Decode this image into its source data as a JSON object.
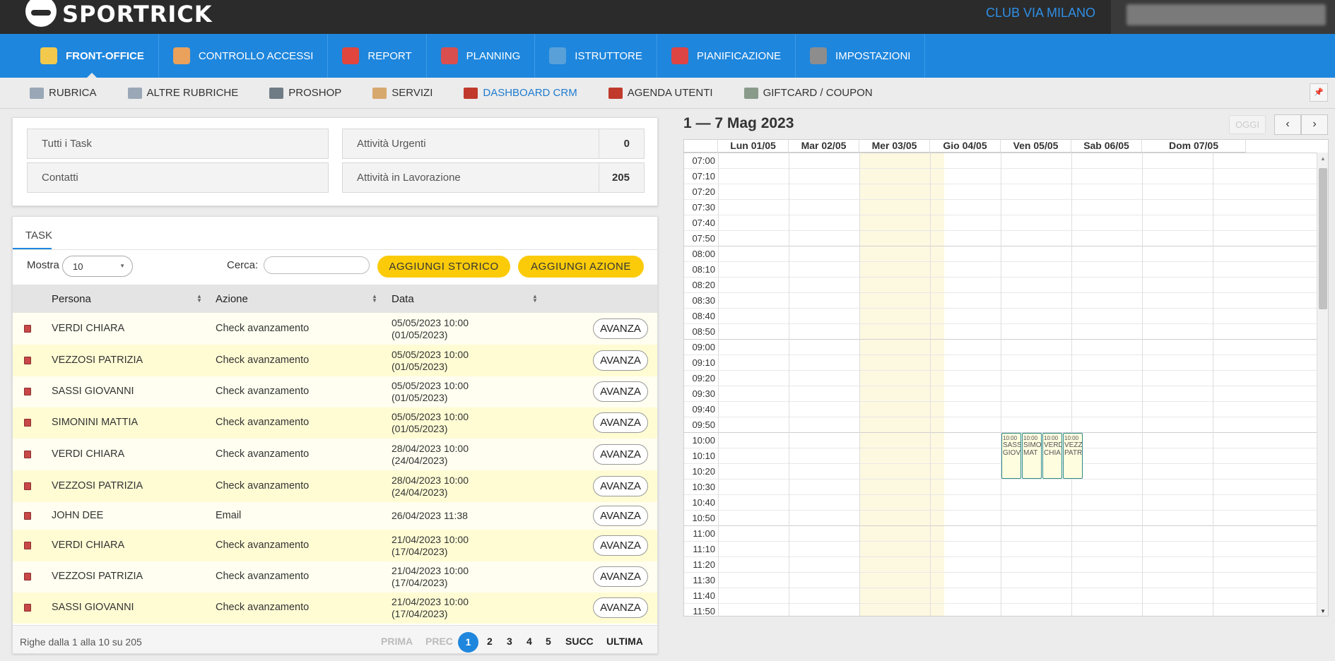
{
  "app": {
    "logo_text": "SPORTRICK",
    "club": "CLUB VIA MILANO"
  },
  "colors": {
    "topbar": "#2b2b2b",
    "nav": "#1e86dd",
    "accent_yellow": "#fbcb0a",
    "link": "#2f8fe6"
  },
  "mainnav": [
    {
      "label": "FRONT-OFFICE",
      "icon": "front-office-icon"
    },
    {
      "label": "CONTROLLO ACCESSI",
      "icon": "access-control-icon"
    },
    {
      "label": "REPORT",
      "icon": "pie-chart-icon"
    },
    {
      "label": "PLANNING",
      "icon": "planning-icon"
    },
    {
      "label": "ISTRUTTORE",
      "icon": "instructor-icon"
    },
    {
      "label": "PIANIFICAZIONE",
      "icon": "calendar-icon"
    },
    {
      "label": "IMPOSTAZIONI",
      "icon": "gear-icon"
    }
  ],
  "subnav": [
    {
      "label": "RUBRICA",
      "icon": "address-book-icon"
    },
    {
      "label": "ALTRE RUBRICHE",
      "icon": "address-book-icon"
    },
    {
      "label": "PROSHOP",
      "icon": "cash-register-icon"
    },
    {
      "label": "SERVIZI",
      "icon": "services-icon"
    },
    {
      "label": "DASHBOARD CRM",
      "icon": "dashboard-icon"
    },
    {
      "label": "AGENDA UTENTI",
      "icon": "agenda-icon"
    },
    {
      "label": "GIFTCARD / COUPON",
      "icon": "giftcard-icon"
    }
  ],
  "pin_icon": "pin-icon",
  "stats": {
    "all_tasks": "Tutti i Task",
    "contacts": "Contatti",
    "urgent_label": "Attività Urgenti",
    "urgent_value": "0",
    "inprogress_label": "Attività in Lavorazione",
    "inprogress_value": "205"
  },
  "task": {
    "tab": "TASK",
    "show_label": "Mostra",
    "show_value": "10",
    "search_label": "Cerca:",
    "search_value": "",
    "add_history": "AGGIUNGI STORICO",
    "add_action": "AGGIUNGI AZIONE",
    "columns": [
      "Persona",
      "Azione",
      "Data"
    ],
    "rows": [
      {
        "persona": "VERDI CHIARA",
        "azione": "Check avanzamento",
        "data1": "05/05/2023 10:00",
        "data2": "(01/05/2023)",
        "btn": "AVANZA"
      },
      {
        "persona": "VEZZOSI PATRIZIA",
        "azione": "Check avanzamento",
        "data1": "05/05/2023 10:00",
        "data2": "(01/05/2023)",
        "btn": "AVANZA"
      },
      {
        "persona": "SASSI GIOVANNI",
        "azione": "Check avanzamento",
        "data1": "05/05/2023 10:00",
        "data2": "(01/05/2023)",
        "btn": "AVANZA"
      },
      {
        "persona": "SIMONINI MATTIA",
        "azione": "Check avanzamento",
        "data1": "05/05/2023 10:00",
        "data2": "(01/05/2023)",
        "btn": "AVANZA"
      },
      {
        "persona": "VERDI CHIARA",
        "azione": "Check avanzamento",
        "data1": "28/04/2023 10:00",
        "data2": "(24/04/2023)",
        "btn": "AVANZA"
      },
      {
        "persona": "VEZZOSI PATRIZIA",
        "azione": "Check avanzamento",
        "data1": "28/04/2023 10:00",
        "data2": "(24/04/2023)",
        "btn": "AVANZA"
      },
      {
        "persona": "JOHN DEE",
        "azione": "Email",
        "data1": "26/04/2023 11:38",
        "data2": "",
        "btn": "AVANZA"
      },
      {
        "persona": "VERDI CHIARA",
        "azione": "Check avanzamento",
        "data1": "21/04/2023 10:00",
        "data2": "(17/04/2023)",
        "btn": "AVANZA"
      },
      {
        "persona": "VEZZOSI PATRIZIA",
        "azione": "Check avanzamento",
        "data1": "21/04/2023 10:00",
        "data2": "(17/04/2023)",
        "btn": "AVANZA"
      },
      {
        "persona": "SASSI GIOVANNI",
        "azione": "Check avanzamento",
        "data1": "21/04/2023 10:00",
        "data2": "(17/04/2023)",
        "btn": "AVANZA"
      }
    ],
    "footer_info": "Righe dalla 1 alla 10 su 205",
    "pagination": {
      "first": "PRIMA",
      "prev": "PREC",
      "pages": [
        "1",
        "2",
        "3",
        "4",
        "5"
      ],
      "current": "1",
      "next": "SUCC",
      "last": "ULTIMA"
    }
  },
  "calendar": {
    "range": "1 — 7 Mag 2023",
    "today_btn": "OGGI",
    "prev_icon": "chevron-left-icon",
    "next_icon": "chevron-right-icon",
    "days": [
      "Lun 01/05",
      "Mar 02/05",
      "Mer 03/05",
      "Gio 04/05",
      "Ven 05/05",
      "Sab 06/05",
      "Dom 07/05"
    ],
    "today_index": 2,
    "times": [
      "07:00",
      "07:10",
      "07:20",
      "07:30",
      "07:40",
      "07:50",
      "08:00",
      "08:10",
      "08:20",
      "08:30",
      "08:40",
      "08:50",
      "09:00",
      "09:10",
      "09:20",
      "09:30",
      "09:40",
      "09:50",
      "10:00",
      "10:10",
      "10:20",
      "10:30",
      "10:40",
      "10:50",
      "11:00",
      "11:10",
      "11:20",
      "11:30",
      "11:40",
      "11:50"
    ],
    "events": [
      {
        "time": "10:00",
        "line1": "SASS",
        "line2": "GIOV"
      },
      {
        "time": "10:00",
        "line1": "SIMO",
        "line2": "MAT"
      },
      {
        "time": "10:00",
        "line1": "VERD",
        "line2": "CHIA"
      },
      {
        "time": "10:00",
        "line1": "VEZZ",
        "line2": "PATR"
      }
    ]
  }
}
